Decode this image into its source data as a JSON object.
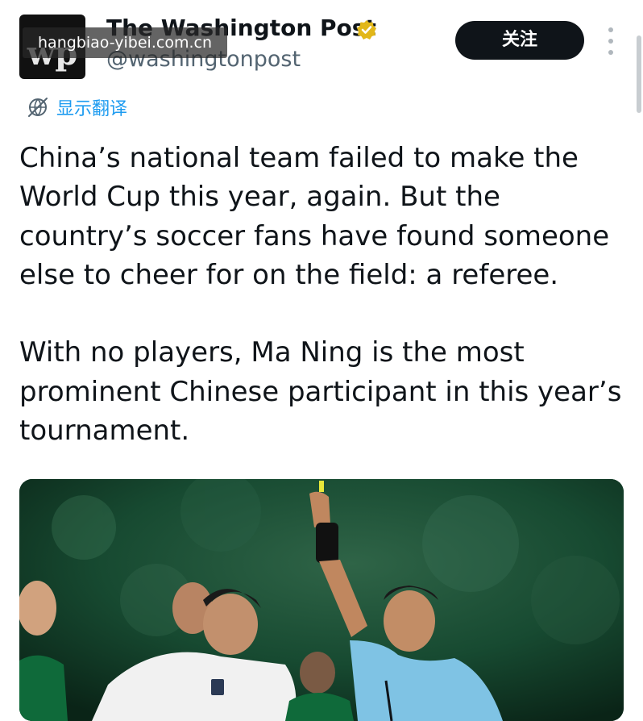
{
  "account": {
    "name": "The Washington Post",
    "handle": "@washingtonpost",
    "avatar_mark": "wp",
    "verified_color": "#e2b719"
  },
  "follow_button": {
    "label": "关注"
  },
  "translate": {
    "label": "显示翻译"
  },
  "tweet": {
    "text": "China’s national team failed to make the World Cup this year, again. But the country’s soccer fans have found someone else to cheer for on the field: a referee.\n\nWith no players, Ma Ning is the most prominent Chinese participant in this year’s tournament."
  },
  "watermark": {
    "text": "hangbiao-yibei.com.cn"
  },
  "colors": {
    "text": "#0f1419",
    "secondary": "#536471",
    "accent": "#1d9bf0",
    "button": "#0f1419",
    "referee_shirt": "#7fc3e4",
    "saudi_green": "#0f6a3a"
  },
  "icons": [
    "verified-badge-icon",
    "more-options-icon",
    "translate-globe-icon"
  ],
  "media": {
    "description_kind": "photo",
    "jersey_badge": "AFC"
  }
}
